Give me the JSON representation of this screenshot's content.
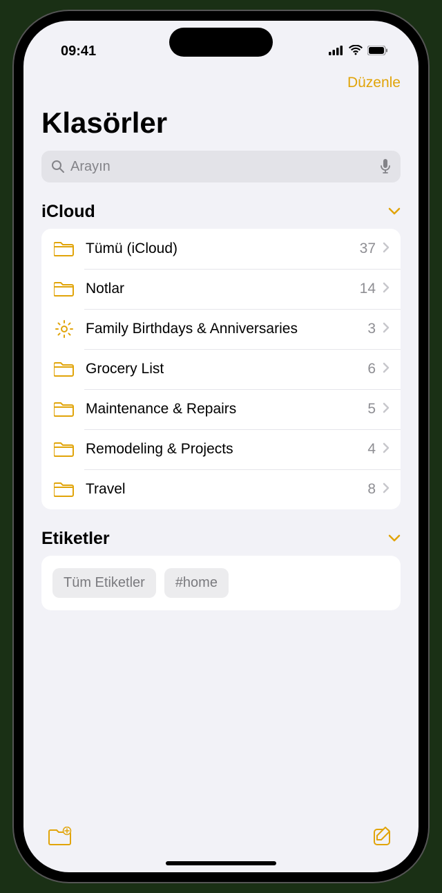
{
  "status_bar": {
    "time": "09:41"
  },
  "nav": {
    "edit_label": "Düzenle"
  },
  "title": "Klasörler",
  "search": {
    "placeholder": "Arayın"
  },
  "sections": {
    "icloud": {
      "title": "iCloud",
      "folders": [
        {
          "name": "Tümü (iCloud)",
          "count": "37",
          "icon": "folder"
        },
        {
          "name": "Notlar",
          "count": "14",
          "icon": "folder"
        },
        {
          "name": "Family Birthdays & Anniversaries",
          "count": "3",
          "icon": "gear"
        },
        {
          "name": "Grocery List",
          "count": "6",
          "icon": "folder"
        },
        {
          "name": "Maintenance & Repairs",
          "count": "5",
          "icon": "folder"
        },
        {
          "name": "Remodeling & Projects",
          "count": "4",
          "icon": "folder"
        },
        {
          "name": "Travel",
          "count": "8",
          "icon": "folder"
        }
      ]
    },
    "tags": {
      "title": "Etiketler",
      "items": [
        "Tüm Etiketler",
        "#home"
      ]
    }
  },
  "colors": {
    "accent": "#e1a409",
    "background": "#f2f2f7"
  }
}
